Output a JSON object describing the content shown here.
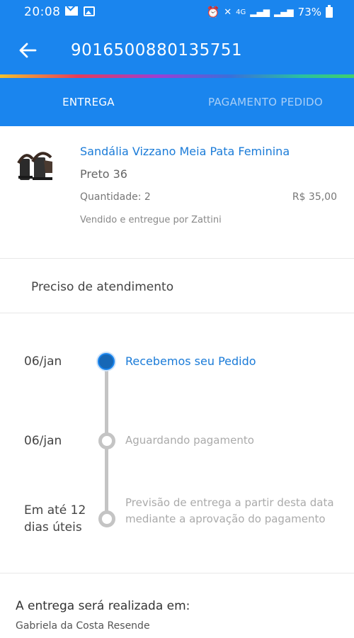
{
  "status_bar": {
    "time": "20:08",
    "network": "4G",
    "battery": "73%"
  },
  "app_bar": {
    "title": "9016500880135751"
  },
  "tabs": [
    {
      "label": "ENTREGA",
      "active": true
    },
    {
      "label": "PAGAMENTO PEDIDO",
      "active": false
    }
  ],
  "product": {
    "name": "Sandália Vizzano Meia Pata Feminina",
    "variant": "Preto 36",
    "quantity": "Quantidade: 2",
    "price": "R$ 35,00",
    "seller": "Vendido e entregue por Zattini"
  },
  "help": {
    "label": "Preciso de atendimento"
  },
  "timeline": [
    {
      "date": "06/jan",
      "text": "Recebemos seu Pedido",
      "state": "active"
    },
    {
      "date": "06/jan",
      "text": "Aguardando pagamento",
      "state": "pending"
    },
    {
      "date": "Em até 12 dias úteis",
      "text": "Previsão de entrega a partir desta data mediante a aprovação do pagamento",
      "state": "pending"
    }
  ],
  "delivery": {
    "title": "A entrega será realizada em:",
    "recipient": "Gabriela da Costa Resende"
  },
  "colors": {
    "primary": "#1a85ee",
    "link": "#1a7bd8",
    "timeline_active": "#1667b6",
    "timeline_pending": "#c4c4c4"
  }
}
